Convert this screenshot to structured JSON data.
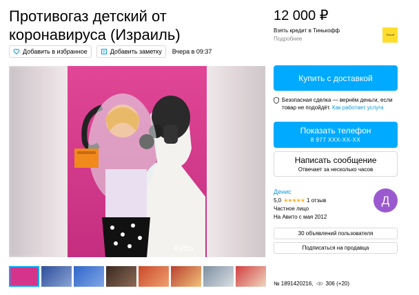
{
  "listing": {
    "title": "Противогаз детский от коронавируса (Израиль)",
    "favorite_label": "Добавить в избранное",
    "note_label": "Добавить заметку",
    "date": "Вчера в 09:37",
    "watermark": "Avito"
  },
  "gallery": {
    "thumbnail_count": 8,
    "active_index": 0
  },
  "sidebar": {
    "price": "12 000 ₽",
    "credit_text": "Взять кредит в Тинькофф",
    "credit_more": "Подробнее",
    "buy_label": "Купить с доставкой",
    "safe_deal_text": "Безопасная сделка — вернём деньги, если товар не подойдёт.",
    "safe_deal_link": "Как работает услуга",
    "phone_label": "Показать телефон",
    "phone_number": "8 977 XXX-XX-XX",
    "message_label": "Написать сообщение",
    "message_sub": "Отвечает за несколько часов",
    "seller": {
      "name": "Денис",
      "rating": "5,0",
      "stars": "★★★★★",
      "reviews": "1 отзыв",
      "type": "Частное лицо",
      "since": "На Авито с мая 2012",
      "avatar_letter": "Д"
    },
    "ads_button": "30 объявлений пользователя",
    "subscribe_button": "Подписаться на продавца",
    "item_number": "№ 1891420216,",
    "views": "306 (+20)"
  },
  "colors": {
    "accent": "#00aaff",
    "link": "#0a9ad8",
    "avatar": "#9b59d0",
    "stars": "#ffb021"
  }
}
